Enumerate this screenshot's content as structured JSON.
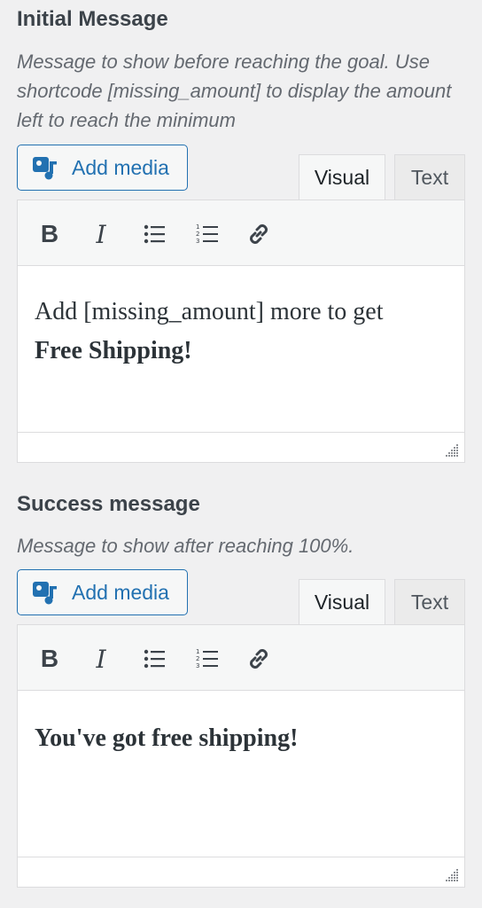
{
  "initial": {
    "heading": "Initial Message",
    "description": "Message to show before reaching the goal. Use shortcode [missing_amount] to display the amount left to reach the minimum",
    "add_media_label": "Add media",
    "tab_visual": "Visual",
    "tab_text": "Text",
    "content_line1": "Add [missing_amount] more to get",
    "content_line2": "Free Shipping!"
  },
  "success": {
    "heading": "Success message",
    "description": "Message to show after reaching 100%.",
    "add_media_label": "Add media",
    "tab_visual": "Visual",
    "tab_text": "Text",
    "content_line1": "You've got free shipping!"
  },
  "toolbar": {
    "bold_glyph": "B",
    "italic_glyph": "I",
    "icons": [
      "bold-icon",
      "italic-icon",
      "bulleted-list-icon",
      "numbered-list-icon",
      "link-icon"
    ]
  },
  "colors": {
    "accent": "#2271b1",
    "background": "#f0f0f1",
    "border": "#dcdcde"
  }
}
